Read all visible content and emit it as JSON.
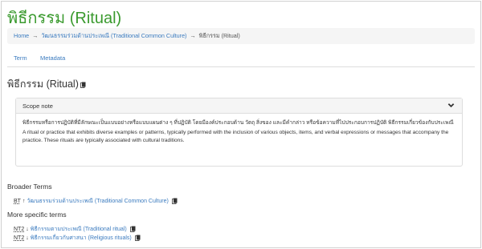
{
  "page": {
    "title": "พิธีกรรม (Ritual)"
  },
  "breadcrumb": {
    "home": "Home",
    "sep1": "→",
    "parent": "วัฒนธรรมร่วมด้านประเพณี (Traditional Common Culture)",
    "sep2": "→",
    "current": "พิธีกรรม (Ritual)"
  },
  "tabs": [
    {
      "label": "Term"
    },
    {
      "label": "Metadata"
    }
  ],
  "term": {
    "heading": "พิธีกรรม (Ritual)",
    "copy_icon": "copy-icon"
  },
  "scope_note": {
    "header": "Scope note",
    "chevron_icon": "chevron-down-icon",
    "thai_text": "พิธีกรรมหรือการปฏิบัติที่มีลักษณะเป็นแบบอย่างหรือแบบแผนต่าง ๆ ที่ปฏิบัติ โดยมีองค์ประกอบด้าน วัตถุ สิ่งของ และมีคำกล่าว หรือข้อความที่ไปประกอบการปฏิบัติ พิธีกรรมเกี่ยวข้องกับประเพณี",
    "english_text": "A ritual or practice that exhibits diverse examples or patterns, typically performed with the inclusion of various objects, items, and verbal expressions or messages that accompany the practice. These rituals are typically associated with cultural traditions."
  },
  "broader": {
    "title": "Broader Terms",
    "items": [
      {
        "code": "BT",
        "arrow": "↑",
        "label": "วัฒนธรรมร่วมด้านประเพณี (Traditional Common Culture)"
      }
    ]
  },
  "specific": {
    "title": "More specific terms",
    "items": [
      {
        "code": "NT2",
        "arrow": "↓",
        "label": "พิธีกรรมตามประเพณี (Traditional ritual)"
      },
      {
        "code": "NT2",
        "arrow": "↓",
        "label": "พิธีกรรมเกี่ยวกับศาสนา (Religious rituals)"
      }
    ]
  },
  "colors": {
    "title_green": "#3a9a2e",
    "link_blue": "#3b7bbf"
  }
}
